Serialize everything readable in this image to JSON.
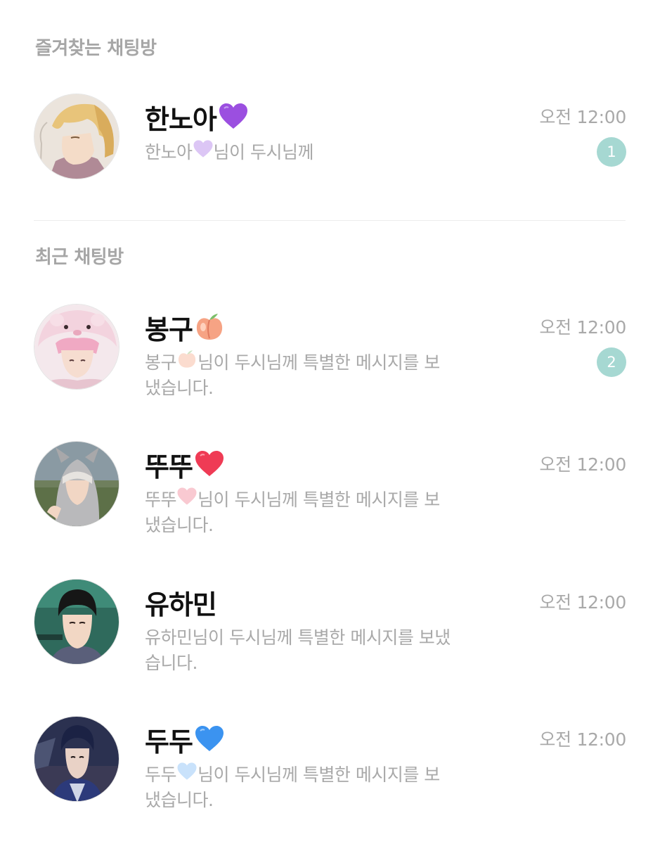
{
  "sections": {
    "favorites_title": "즐겨찾는 채팅방",
    "recent_title": "최근 채팅방"
  },
  "colors": {
    "badge": "#a6d8d2",
    "secondary_text": "#a9a9a9",
    "section_title": "#a6a6a6"
  },
  "favorites": [
    {
      "name": "한노아",
      "emoji": "purple-heart",
      "preview_prefix": "한노아",
      "preview_rest": "님이 두시님께",
      "time": "오전 12:00",
      "unread": "1"
    }
  ],
  "recent": [
    {
      "name": "봉구",
      "emoji": "peach",
      "preview_prefix": "봉구",
      "preview_rest": "님이 두시님께 특별한 메시지를 보냈습니다.",
      "time": "오전 12:00",
      "unread": "2"
    },
    {
      "name": "뚜뚜",
      "emoji": "red-heart",
      "preview_prefix": "뚜뚜",
      "preview_rest": "님이 두시님께 특별한 메시지를 보냈습니다.",
      "time": "오전 12:00",
      "unread": ""
    },
    {
      "name": "유하민",
      "emoji": "",
      "preview_prefix": "유하민",
      "preview_rest": "님이 두시님께 특별한 메시지를 보냈습니다.",
      "time": "오전 12:00",
      "unread": ""
    },
    {
      "name": "두두",
      "emoji": "blue-heart",
      "preview_prefix": "두두",
      "preview_rest": "님이 두시님께 특별한 메시지를 보냈습니다.",
      "time": "오전 12:00",
      "unread": ""
    }
  ]
}
